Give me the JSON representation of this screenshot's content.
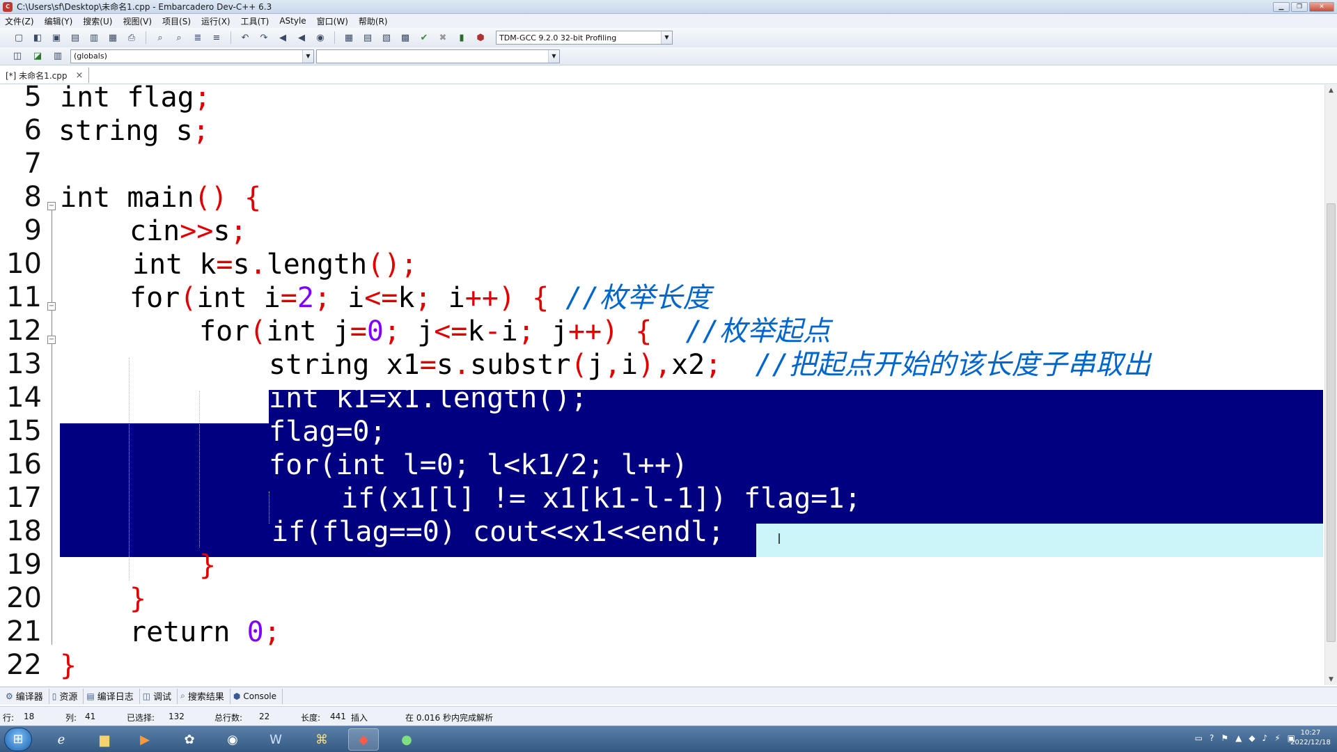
{
  "window": {
    "title": "C:\\Users\\sf\\Desktop\\未命名1.cpp - Embarcadero Dev-C++ 6.3",
    "controls": [
      "minimize",
      "maximize",
      "close"
    ]
  },
  "menu": [
    "文件(Z)",
    "编辑(Y)",
    "搜索(U)",
    "视图(V)",
    "项目(S)",
    "运行(X)",
    "工具(T)",
    "AStyle",
    "窗口(W)",
    "帮助(R)"
  ],
  "toolbar": {
    "compiler_select": "TDM-GCC 9.2.0 32-bit Profiling",
    "scope_select": "(globals)",
    "member_select": ""
  },
  "file_tab": {
    "label": "[*] 未命名1.cpp",
    "close": "×"
  },
  "editor": {
    "line_numbers": [
      "5",
      "6",
      "7",
      "8",
      "9",
      "10",
      "11",
      "12",
      "13",
      "14",
      "15",
      "16",
      "17",
      "18",
      "19",
      "20",
      "21",
      "22"
    ],
    "code": {
      "l5": {
        "kw": "int",
        "rest": " flag",
        "semi": ";"
      },
      "l6": {
        "kw": "string",
        "rest": " s",
        "semi": ";"
      },
      "l8": {
        "kw": "int",
        "rest": " main",
        "paren": "()",
        "brace": "{"
      },
      "l9": {
        "a": "cin",
        "op": ">>",
        "b": "s",
        "semi": ";"
      },
      "l10": {
        "kw": "int",
        "a": " k",
        "eq": "=",
        "b": "s",
        "dot": ".",
        "c": "length",
        "paren": "()",
        "semi": ";"
      },
      "l11": {
        "kw": "for",
        "p1": "(",
        "kw2": "int",
        "a": " i",
        "eq": "=",
        "n": "2",
        "s1": "; ",
        "b": "i",
        "le": "<=",
        "c": "k",
        "s2": "; ",
        "d": "i",
        "pp": "++)",
        "brace": "{",
        "cmt": "//枚举长度"
      },
      "l12": {
        "kw": "for",
        "p1": "(",
        "kw2": "int",
        "a": " j",
        "eq": "=",
        "n": "0",
        "s1": "; ",
        "b": "j",
        "le": "<=",
        "c": "k",
        "m": "-",
        "d": "i",
        "s2": "; ",
        "e": "j",
        "pp": "++)",
        "brace": "{",
        "cmt": "//枚举起点"
      },
      "l13": {
        "kw": "string",
        "a": " x1",
        "eq": "=",
        "b": "s",
        "dot": ".",
        "c": "substr",
        "p1": "(",
        "d": "j",
        "comma": ",",
        "e": "i",
        "p2": ")",
        "comma2": ",",
        "f": "x2",
        "semi": ";",
        "cmt": "//把起点开始的该长度子串取出"
      },
      "l14": "int k1=x1.length();",
      "l15": "flag=0;",
      "l16": "for(int l=0; l<k1/2; l++)",
      "l17": "if(x1[l] != x1[k1-l-1]) flag=1;",
      "l18": "if(flag==0) cout<<x1<<endl;",
      "l19": "}",
      "l20": "}",
      "l21": {
        "kw": "return",
        "n": "0",
        "semi": ";"
      },
      "l22": "}"
    }
  },
  "bottom_tabs": [
    "编译器",
    "资源",
    "编译日志",
    "调试",
    "搜索结果",
    "Console"
  ],
  "status": {
    "row_label": "行:",
    "row": "18",
    "col_label": "列:",
    "col": "41",
    "selected_label": "已选择:",
    "selected": "132",
    "total_label": "总行数:",
    "total": "22",
    "length_label": "长度:",
    "length": "441",
    "mode": "插入",
    "parse": "在 0.016 秒内完成解析"
  },
  "taskbar": {
    "clock_time": "10:27",
    "clock_date": "2022/12/18"
  }
}
